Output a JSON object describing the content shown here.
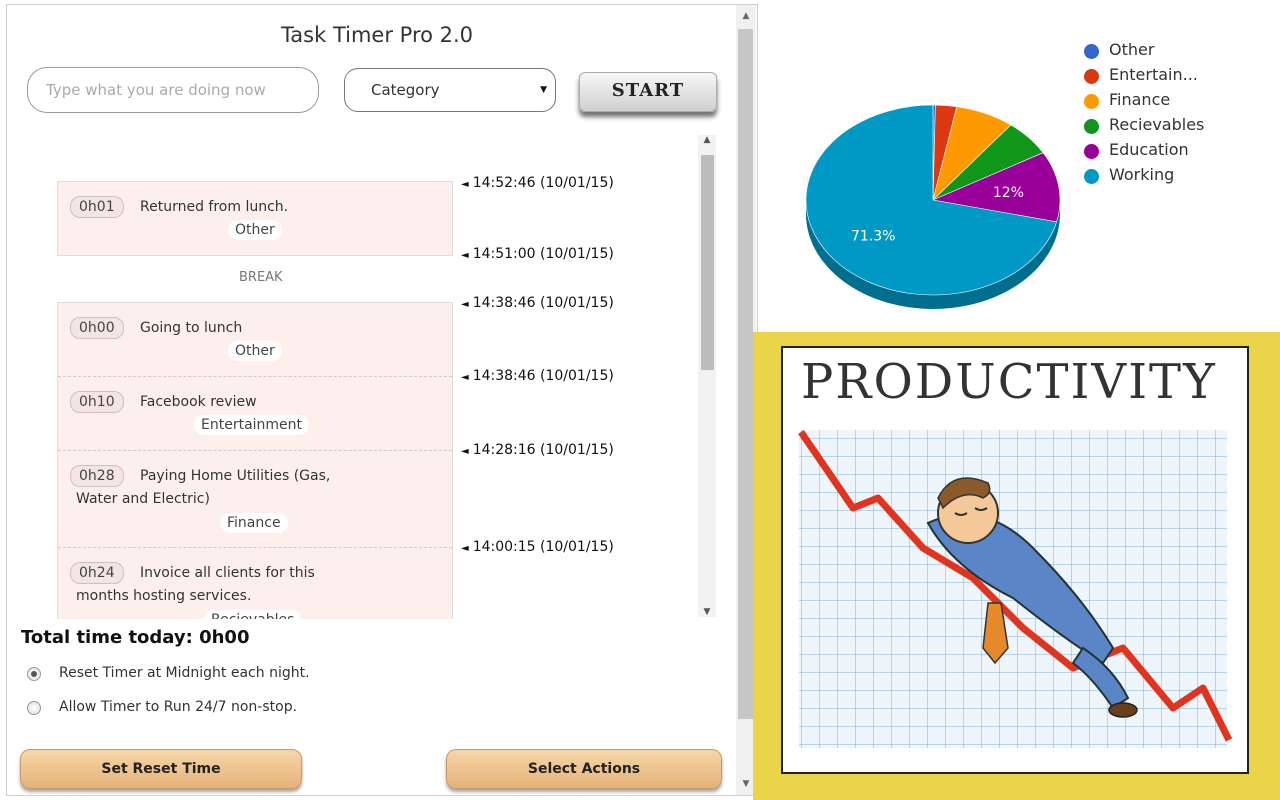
{
  "app": {
    "title": "Task Timer Pro 2.0",
    "task_input_placeholder": "Type what you are doing now",
    "category_select": {
      "selected": "Category"
    },
    "start_label": "START"
  },
  "log": {
    "blocks": [
      {
        "start": "14:52:46 (10/01/15)",
        "end": "14:51:00 (10/01/15)",
        "entries": [
          {
            "duration": "0h01",
            "description": "Returned from lunch.",
            "category": "Other"
          }
        ]
      },
      {
        "start": "14:38:46 (10/01/15)",
        "entries": [
          {
            "duration": "0h00",
            "description": "Going to lunch",
            "category": "Other",
            "next_time": "14:38:46 (10/01/15)"
          },
          {
            "duration": "0h10",
            "description": "Facebook review",
            "category": "Entertainment",
            "next_time": "14:28:16 (10/01/15)"
          },
          {
            "duration": "0h28",
            "description": "Paying Home Utilities (Gas,",
            "description_line2": "Water and Electric)",
            "category": "Finance",
            "next_time": "14:00:15 (10/01/15)"
          },
          {
            "duration": "0h24",
            "description": "Invoice all clients for this",
            "description_line2": "months hosting services.",
            "category": "Recievables"
          }
        ]
      }
    ],
    "break_label": "BREAK"
  },
  "footer": {
    "total_label": "Total time today: 0h00",
    "options": [
      {
        "label": "Reset Timer at Midnight each night.",
        "checked": true
      },
      {
        "label": "Allow Timer to Run 24/7 non-stop.",
        "checked": false
      }
    ],
    "set_reset_label": "Set Reset Time",
    "select_actions_label": "Select Actions"
  },
  "chart_data": {
    "type": "pie",
    "legend": [
      {
        "name": "Other",
        "color": "#3366cc"
      },
      {
        "name": "Entertain...",
        "color": "#dc3912"
      },
      {
        "name": "Finance",
        "color": "#ff9900"
      },
      {
        "name": "Recievables",
        "color": "#109618"
      },
      {
        "name": "Education",
        "color": "#990099"
      },
      {
        "name": "Working",
        "color": "#0099c6"
      }
    ],
    "values": [
      0.3,
      2.7,
      7.5,
      6.2,
      12,
      71.3
    ],
    "slice_labels": [
      "",
      "",
      "",
      "",
      "12%",
      "71.3%"
    ],
    "legend_position": "top-right"
  },
  "poster": {
    "title": "PRODUCTIVITY"
  }
}
